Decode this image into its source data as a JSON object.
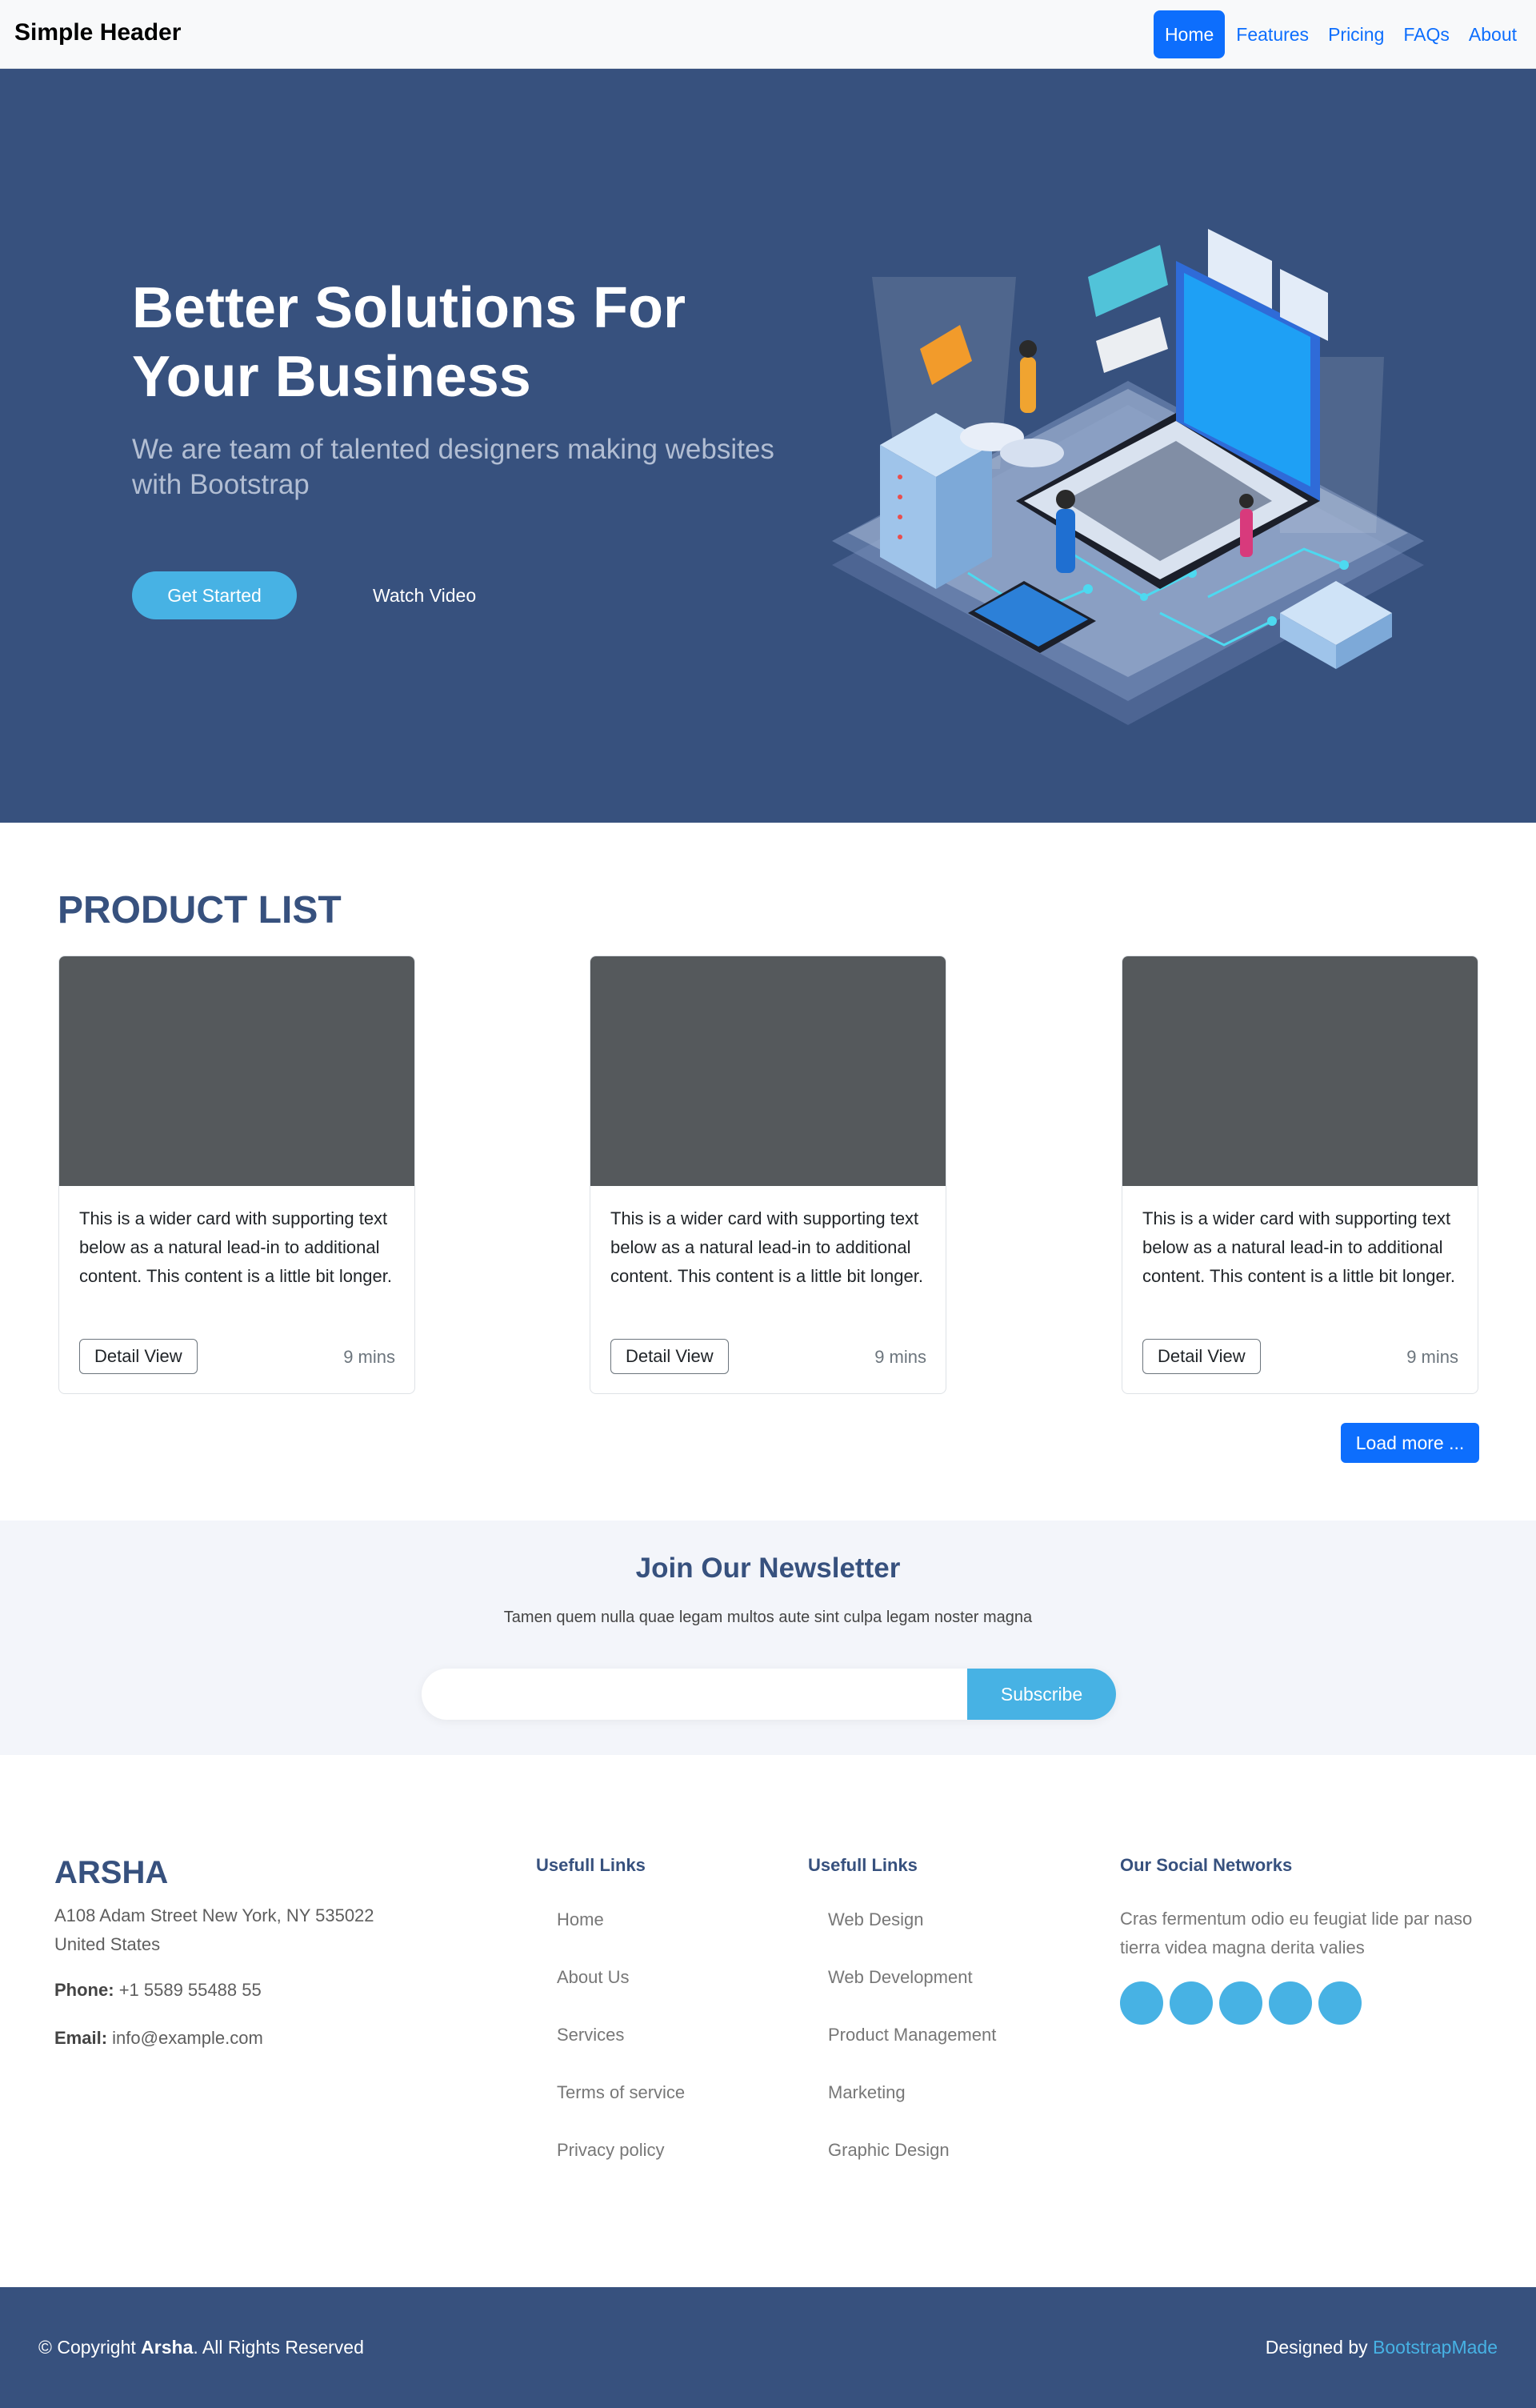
{
  "header": {
    "brand": "Simple Header",
    "nav": [
      "Home",
      "Features",
      "Pricing",
      "FAQs",
      "About"
    ],
    "active": "Home"
  },
  "hero": {
    "title_line1": "Better Solutions For",
    "title_line2": "Your Business",
    "subtitle": "We are team of talented designers making websites with Bootstrap",
    "primary_button": "Get Started",
    "secondary_button": "Watch Video"
  },
  "products": {
    "title": "PRODUCT LIST",
    "cards": [
      {
        "text": "This is a wider card with supporting text below as a natural lead-in to additional content. This content is a little bit longer.",
        "button": "Detail View",
        "time": "9 mins"
      },
      {
        "text": "This is a wider card with supporting text below as a natural lead-in to additional content. This content is a little bit longer.",
        "button": "Detail View",
        "time": "9 mins"
      },
      {
        "text": "This is a wider card with supporting text below as a natural lead-in to additional content. This content is a little bit longer.",
        "button": "Detail View",
        "time": "9 mins"
      }
    ],
    "load_more": "Load more ..."
  },
  "newsletter": {
    "title": "Join Our Newsletter",
    "subtitle": "Tamen quem nulla quae legam multos aute sint culpa legam noster magna",
    "input_value": "",
    "button": "Subscribe"
  },
  "footer": {
    "brand": "ARSHA",
    "address": "A108 Adam Street New York, NY 535022 United States",
    "phone_label": "Phone:",
    "phone": "+1 5589 55488 55",
    "email_label": "Email:",
    "email": "info@example.com",
    "col1_title": "Usefull Links",
    "col1_links": [
      "Home",
      "About Us",
      "Services",
      "Terms of service",
      "Privacy policy"
    ],
    "col2_title": "Usefull Links",
    "col2_links": [
      "Web Design",
      "Web Development",
      "Product Management",
      "Marketing",
      "Graphic Design"
    ],
    "social_title": "Our Social Networks",
    "social_text": "Cras fermentum odio eu feugiat lide par naso tierra videa magna derita valies",
    "social_icons": [
      "social-icon-1",
      "social-icon-2",
      "social-icon-3",
      "social-icon-4",
      "social-icon-5"
    ]
  },
  "bottom": {
    "copy_prefix": "© Copyright",
    "copy_brand": "Arsha",
    "copy_suffix": ". All Rights Reserved",
    "designed_prefix": "Designed by",
    "designed_link": "BootstrapMade"
  },
  "colors": {
    "primary": "#37517e",
    "accent": "#47b2e4",
    "bootstrap_blue": "#0d6efd",
    "card_image": "#55595c"
  }
}
